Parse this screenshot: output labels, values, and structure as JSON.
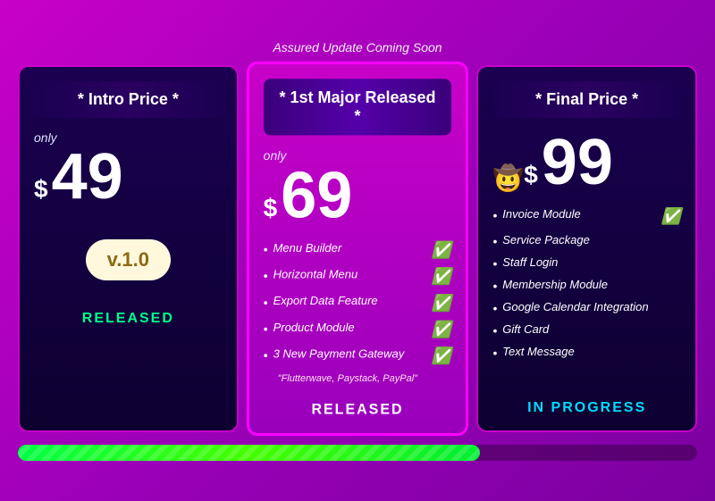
{
  "header": {
    "label": "Assured Update Coming Soon"
  },
  "cards": [
    {
      "id": "intro",
      "title": "* Intro Price *",
      "price_prefix": "only",
      "price_symbol": "$",
      "price_value": "49",
      "version": "v.1.0",
      "status": "RELEASED",
      "status_type": "released"
    },
    {
      "id": "major",
      "title": "* 1st Major Released *",
      "price_prefix": "only",
      "price_symbol": "$",
      "price_value": "69",
      "features": [
        {
          "text": "Menu Builder",
          "checked": true
        },
        {
          "text": "Horizontal Menu",
          "checked": true
        },
        {
          "text": "Export Data Feature",
          "checked": true
        },
        {
          "text": "Product Module",
          "checked": true
        },
        {
          "text": "3 New Payment Gateway",
          "checked": true
        }
      ],
      "feature_note": "\"Flutterwave, Paystack, PayPal\"",
      "status": "RELEASED",
      "status_type": "released"
    },
    {
      "id": "final",
      "title": "* Final Price *",
      "price_prefix": "",
      "price_symbol": "$",
      "price_value": "99",
      "emoji": "🤠",
      "features": [
        {
          "text": "Invoice Module",
          "checked": true
        },
        {
          "text": "Service Package",
          "checked": false
        },
        {
          "text": "Staff Login",
          "checked": false
        },
        {
          "text": "Membership Module",
          "checked": false
        },
        {
          "text": "Google Calendar Integration",
          "checked": false
        },
        {
          "text": "Gift Card",
          "checked": false
        },
        {
          "text": "Text Message",
          "checked": false
        }
      ],
      "status": "IN PROGRESS",
      "status_type": "progress"
    }
  ],
  "progress": {
    "width_percent": 68
  }
}
